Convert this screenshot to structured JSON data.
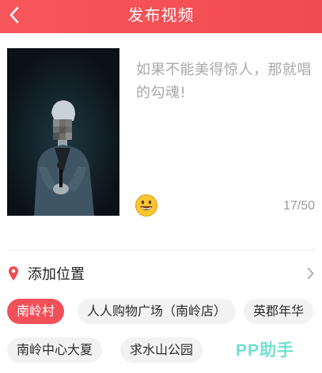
{
  "header": {
    "title": "发布视频",
    "back_icon": "chevron-left-icon",
    "background_color": "#f44e56"
  },
  "post": {
    "caption": "如果不能美得惊人，那就唱的勾魂!",
    "char_count": "17/50",
    "emoji_icon": "smiley-face-icon"
  },
  "location": {
    "pin_icon": "location-pin-icon",
    "label": "添加位置",
    "chevron_icon": "chevron-right-icon",
    "pin_color": "#f24a52"
  },
  "location_tags": [
    {
      "label": "南岭村",
      "selected": true
    },
    {
      "label": "人人购物广场（南岭店）",
      "selected": false
    },
    {
      "label": "英郡年华",
      "selected": false
    },
    {
      "label": "南岭中心大夏",
      "selected": false
    },
    {
      "label": "求水山公园",
      "selected": false
    }
  ],
  "watermark": "PP助手"
}
